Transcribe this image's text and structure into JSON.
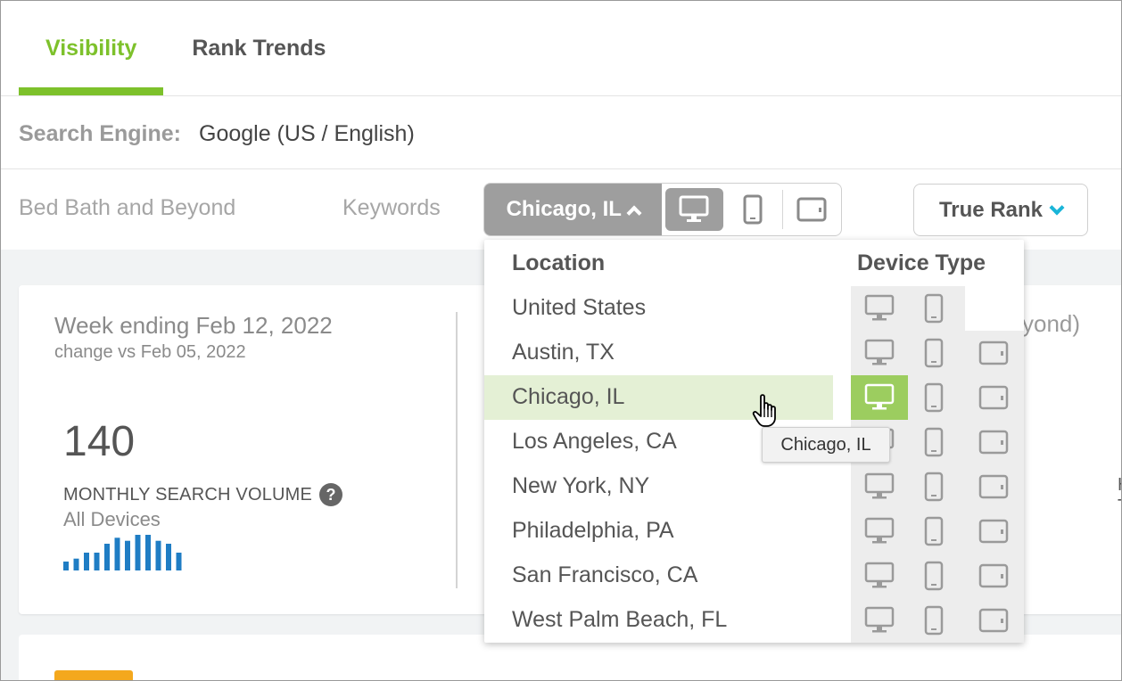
{
  "tabs": [
    {
      "label": "Visibility",
      "active": true
    },
    {
      "label": "Rank Trends",
      "active": false
    }
  ],
  "search_engine": {
    "label": "Search Engine:",
    "value": "Google (US / English)"
  },
  "filters": {
    "brand": "Bed Bath and Beyond",
    "keywords": "Keywords",
    "location_button": "Chicago, IL",
    "rank_button": "True Rank"
  },
  "card": {
    "week": "Week ending Feb 12, 2022",
    "change": "change vs Feb 05, 2022",
    "volume": "140",
    "volume_label": "MONTHLY SEARCH VOLUME",
    "help": "?",
    "devices": "All Devices",
    "partial_right_title": "yond)",
    "edge_chars": [
      "H",
      "T"
    ],
    "sparkline_values": [
      3,
      4,
      6,
      6,
      9,
      11,
      10,
      12,
      12,
      10,
      9,
      6
    ]
  },
  "dropdown": {
    "location_header": "Location",
    "device_header": "Device Type",
    "locations": [
      {
        "name": "United States",
        "devices": [
          "desktop",
          "mobile"
        ],
        "selected": false
      },
      {
        "name": "Austin, TX",
        "devices": [
          "desktop",
          "mobile",
          "tablet"
        ],
        "selected": false
      },
      {
        "name": "Chicago, IL",
        "devices": [
          "desktop",
          "mobile",
          "tablet"
        ],
        "selected": true
      },
      {
        "name": "Los Angeles, CA",
        "devices": [
          "desktop",
          "mobile",
          "tablet"
        ],
        "selected": false
      },
      {
        "name": "New York, NY",
        "devices": [
          "desktop",
          "mobile",
          "tablet"
        ],
        "selected": false
      },
      {
        "name": "Philadelphia, PA",
        "devices": [
          "desktop",
          "mobile",
          "tablet"
        ],
        "selected": false
      },
      {
        "name": "San Francisco, CA",
        "devices": [
          "desktop",
          "mobile",
          "tablet"
        ],
        "selected": false
      },
      {
        "name": "West Palm Beach, FL",
        "devices": [
          "desktop",
          "mobile",
          "tablet"
        ],
        "selected": false
      }
    ],
    "tooltip": "Chicago, IL"
  },
  "colors": {
    "accent_green": "#7dc12b",
    "selected_green": "#9ccd5f",
    "highlight_row": "#e4f0d5",
    "chevron_blue": "#1ab5d8",
    "spark_blue": "#1f7dc4"
  }
}
